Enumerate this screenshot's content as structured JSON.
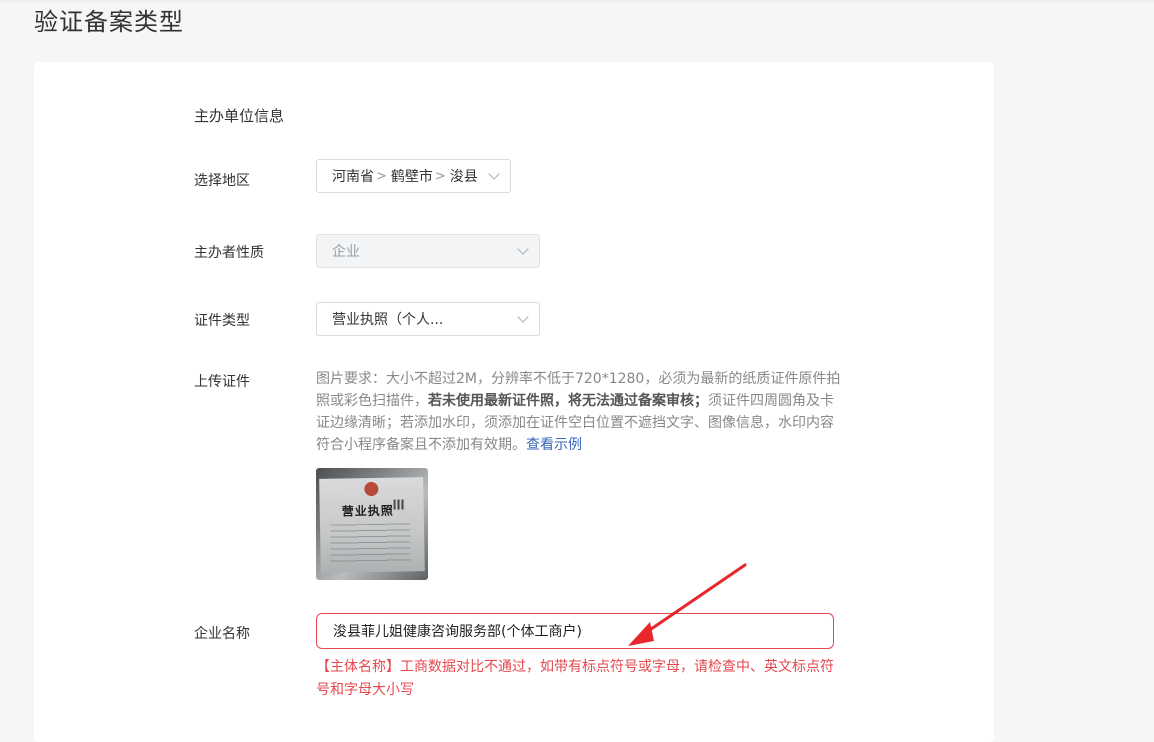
{
  "page": {
    "title": "验证备案类型"
  },
  "form": {
    "section_title": "主办单位信息",
    "region": {
      "label": "选择地区",
      "province": "河南省",
      "city": "鹤壁市",
      "county": "浚县",
      "separator": ">"
    },
    "organizer_type": {
      "label": "主办者性质",
      "value": "企业",
      "disabled": true
    },
    "certificate_type": {
      "label": "证件类型",
      "value": "营业执照（个人..."
    },
    "upload": {
      "label": "上传证件",
      "requirements_part1": "图片要求：大小不超过2M，分辨率不低于720*1280，必须为最新的纸质证件原件拍照或彩色扫描件，",
      "requirements_bold": "若未使用最新证件照，将无法通过备案审核；",
      "requirements_part2": "须证件四周圆角及卡证边缘清晰；若添加水印，须添加在证件空白位置不遮挡文字、图像信息，水印内容符合小程序备案且不添加有效期。",
      "example_link": "查看示例",
      "thumbnail": {
        "doc_title": "营业执照"
      }
    },
    "company_name": {
      "label": "企业名称",
      "value": "浚县菲儿姐健康咨询服务部(个体工商户)",
      "error": "【主体名称】工商数据对比不通过，如带有标点符号或字母，请检查中、英文标点符号和字母大小写"
    }
  },
  "colors": {
    "error": "#e5484d",
    "link": "#3a66b8",
    "annotation_arrow": "#e8262b"
  }
}
